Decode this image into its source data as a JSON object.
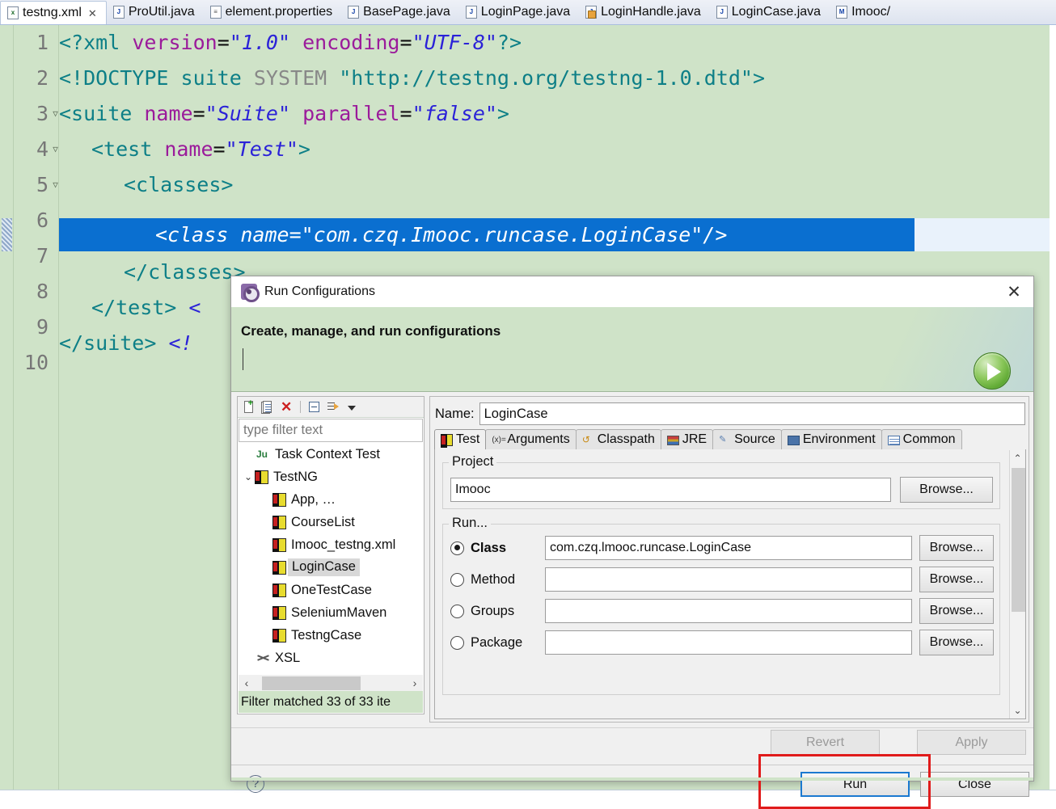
{
  "editor": {
    "tabs": [
      {
        "label": "testng.xml",
        "icon": "xml-file-icon",
        "icon_text": "x",
        "active": true,
        "closeable": true
      },
      {
        "label": "ProUtil.java",
        "icon": "java-file-icon",
        "icon_text": "J",
        "active": false,
        "closeable": false
      },
      {
        "label": "element.properties",
        "icon": "properties-file-icon",
        "icon_text": "≡",
        "active": false,
        "closeable": false
      },
      {
        "label": "BasePage.java",
        "icon": "java-file-icon",
        "icon_text": "J",
        "active": false,
        "closeable": false
      },
      {
        "label": "LoginPage.java",
        "icon": "java-file-icon",
        "icon_text": "J",
        "active": false,
        "closeable": false
      },
      {
        "label": "LoginHandle.java",
        "icon": "java-file-locked-icon",
        "icon_text": "J",
        "active": false,
        "closeable": false
      },
      {
        "label": "LoginCase.java",
        "icon": "java-file-icon",
        "icon_text": "J",
        "active": false,
        "closeable": false
      },
      {
        "label": "Imooc/",
        "icon": "markup-file-icon",
        "icon_text": "M",
        "active": false,
        "closeable": false
      }
    ],
    "close_glyph": "✕",
    "line_numbers": [
      "1",
      "2",
      "3",
      "4",
      "5",
      "6",
      "7",
      "8",
      "9",
      "10"
    ],
    "selected_line": 6,
    "selected_line_text": "<class name=\"com.czq.Imooc.runcase.LoginCase\"/>",
    "selection_color": "#0a6fd0",
    "background_color": "#cfe3c8",
    "lines": {
      "l1": {
        "tag_open": "<?xml",
        "attr1": "version",
        "val1": "\"1.0\"",
        "attr2": "encoding",
        "val2": "\"UTF-8\"",
        "tag_close": "?>"
      },
      "l2": {
        "doctype": "<!DOCTYPE",
        "name": "suite",
        "system": "SYSTEM",
        "dtd": "\"http://testng.org/testng-1.0.dtd\">"
      },
      "l3": {
        "tag_open": "<suite",
        "attr1": "name",
        "val1": "\"Suite\"",
        "attr2": "parallel",
        "val2": "\"false\"",
        "tag_close": ">"
      },
      "l4": {
        "tag_open": "<test",
        "attr1": "name",
        "val1": "\"Test\"",
        "tag_close": ">"
      },
      "l5": {
        "tag": "<classes>"
      },
      "l7": {
        "tag": "</classes>"
      },
      "l8": {
        "tag": "</test>",
        "extra": "<"
      },
      "l9": {
        "tag": "</suite>",
        "extra": "<!"
      }
    }
  },
  "dialog": {
    "title": "Run Configurations",
    "title_icon": "run-configurations-gear-icon",
    "close_glyph": "✕",
    "banner_title": "Create, manage, and run configurations",
    "run_icon": "green-run-play-icon",
    "toolbar": [
      {
        "name": "new-configuration-icon",
        "tip": "New launch configuration"
      },
      {
        "name": "duplicate-configuration-icon",
        "tip": "Duplicate"
      },
      {
        "name": "delete-configuration-icon",
        "tip": "Delete"
      },
      {
        "name": "collapse-all-icon",
        "tip": "Collapse All"
      },
      {
        "name": "filter-configurations-icon",
        "tip": "Filter"
      },
      {
        "name": "view-menu-chevron-icon",
        "tip": "View Menu"
      }
    ],
    "filter": {
      "placeholder": "type filter text",
      "value": ""
    },
    "tree": [
      {
        "label": "Task Context Test",
        "icon": "junit-icon",
        "indent": 1,
        "expander": "",
        "selected": false
      },
      {
        "label": "TestNG",
        "icon": "testng-icon",
        "indent": 0,
        "expander": "⌄",
        "selected": false
      },
      {
        "label": "App, …",
        "icon": "testng-icon",
        "indent": 2,
        "expander": "",
        "selected": false
      },
      {
        "label": "CourseList",
        "icon": "testng-icon",
        "indent": 2,
        "expander": "",
        "selected": false
      },
      {
        "label": "Imooc_testng.xml",
        "icon": "testng-icon",
        "indent": 2,
        "expander": "",
        "selected": false
      },
      {
        "label": "LoginCase",
        "icon": "testng-icon",
        "indent": 2,
        "expander": "",
        "selected": true
      },
      {
        "label": "OneTestCase",
        "icon": "testng-icon",
        "indent": 2,
        "expander": "",
        "selected": false
      },
      {
        "label": "SeleniumMaven",
        "icon": "testng-icon",
        "indent": 2,
        "expander": "",
        "selected": false
      },
      {
        "label": "TestngCase",
        "icon": "testng-icon",
        "indent": 2,
        "expander": "",
        "selected": false
      },
      {
        "label": "XSL",
        "icon": "xsl-icon",
        "indent": 1,
        "expander": "",
        "selected": false
      }
    ],
    "scroll_left_glyph": "‹",
    "scroll_right_glyph": "›",
    "filter_status": "Filter matched 33 of 33 ite",
    "name": {
      "label": "Name:",
      "value": "LoginCase"
    },
    "tabs": [
      {
        "label": "Test",
        "icon": "testng-tab-icon",
        "active": true
      },
      {
        "label": "Arguments",
        "icon": "arguments-tab-icon",
        "active": false
      },
      {
        "label": "Classpath",
        "icon": "classpath-tab-icon",
        "active": false
      },
      {
        "label": "JRE",
        "icon": "jre-tab-icon",
        "active": false
      },
      {
        "label": "Source",
        "icon": "source-tab-icon",
        "active": false
      },
      {
        "label": "Environment",
        "icon": "environment-tab-icon",
        "active": false
      },
      {
        "label": "Common",
        "icon": "common-tab-icon",
        "active": false
      }
    ],
    "project": {
      "group_label": "Project",
      "value": "Imooc",
      "browse_label": "Browse..."
    },
    "run": {
      "group_label": "Run...",
      "options": [
        {
          "label": "Class",
          "checked": true,
          "value": "com.czq.lmooc.runcase.LoginCase",
          "browse_label": "Browse..."
        },
        {
          "label": "Method",
          "checked": false,
          "value": "",
          "browse_label": "Browse..."
        },
        {
          "label": "Groups",
          "checked": false,
          "value": "",
          "browse_label": "Browse..."
        },
        {
          "label": "Package",
          "checked": false,
          "value": "",
          "browse_label": "Browse..."
        }
      ]
    },
    "scroll_up_glyph": "⌃",
    "scroll_down_glyph": "⌄",
    "footer": {
      "revert_label": "Revert",
      "revert_enabled": false,
      "apply_label": "Apply",
      "apply_enabled": false,
      "run_label": "Run",
      "close_label": "Close",
      "help_glyph": "?",
      "highlight_color": "#e01b1b",
      "focus_color": "#1b79d0"
    }
  }
}
